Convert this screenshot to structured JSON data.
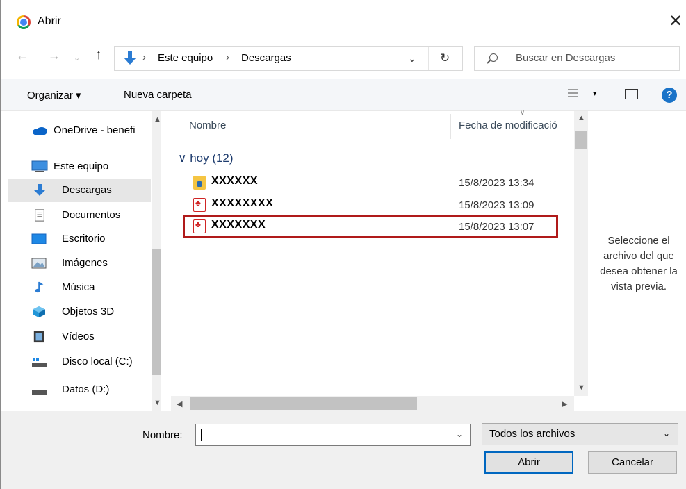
{
  "window": {
    "title": "Abrir",
    "close_glyph": "✕"
  },
  "address": {
    "crumbs": [
      "Este equipo",
      "Descargas"
    ],
    "separator": "›",
    "refresh_glyph": "↻",
    "dropdown_glyph": "⌄"
  },
  "search": {
    "placeholder": "Buscar en Descargas"
  },
  "nav_glyphs": {
    "back": "←",
    "forward": "→",
    "recent": "⌄",
    "up": "↑"
  },
  "commands": {
    "organize": "Organizar ▾",
    "new_folder": "Nueva carpeta",
    "view_dropdown": "▾",
    "help": "?"
  },
  "sidebar": {
    "items": [
      {
        "label": "OneDrive - benefi",
        "icon": "cloud-icon"
      },
      {
        "label": "Este equipo",
        "icon": "computer-icon"
      },
      {
        "label": "Descargas",
        "icon": "download-icon",
        "selected": true
      },
      {
        "label": "Documentos",
        "icon": "document-icon"
      },
      {
        "label": "Escritorio",
        "icon": "desktop-icon"
      },
      {
        "label": "Imágenes",
        "icon": "image-icon"
      },
      {
        "label": "Música",
        "icon": "music-icon"
      },
      {
        "label": "Objetos 3D",
        "icon": "cube-icon"
      },
      {
        "label": "Vídeos",
        "icon": "video-icon"
      },
      {
        "label": "Disco local (C:)",
        "icon": "drive-icon"
      },
      {
        "label": "Datos (D:)",
        "icon": "drive-icon"
      }
    ]
  },
  "filelist": {
    "columns": {
      "name": "Nombre",
      "modified": "Fecha de modificació"
    },
    "group_label": "hoy (12)",
    "group_chevron": "∨",
    "files": [
      {
        "name": "XXXXXX",
        "date": "15/8/2023 13:34",
        "icon": "secure-file-icon"
      },
      {
        "name": "XXXXXXXX",
        "date": "15/8/2023 13:09",
        "icon": "pdf-icon"
      },
      {
        "name": "XXXXXXX",
        "date": "15/8/2023 13:07",
        "icon": "pdf-icon",
        "highlighted": true
      }
    ]
  },
  "preview": {
    "message": "Seleccione el archivo del que desea obtener la vista previa."
  },
  "footer": {
    "name_label": "Nombre:",
    "name_value": "",
    "filter_value": "Todos los archivos",
    "open_button": "Abrir",
    "cancel_button": "Cancelar"
  },
  "colors": {
    "highlight_border": "#b01a1a",
    "accent": "#0067c0",
    "help_blue": "#1a73c8"
  }
}
